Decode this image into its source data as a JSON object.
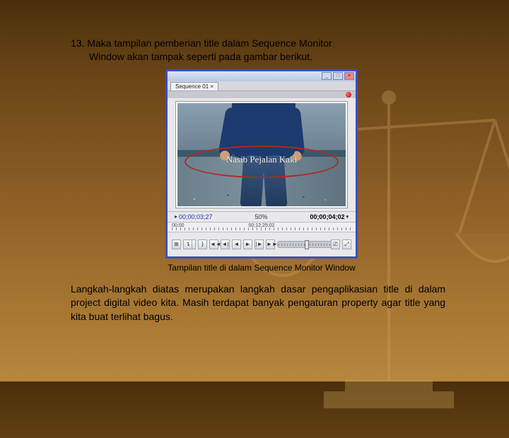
{
  "step": {
    "number": "13.",
    "line1": "13. Maka tampilan pemberian title dalam Sequence Monitor",
    "line2": "Window akan tampak seperti pada gambar berikut."
  },
  "monitor": {
    "tab_label": "Sequence 01 ×",
    "overlay_title": "Nasib Pejalan Kaki",
    "timecode_left": "00;00;03;27",
    "zoom": "50%",
    "timecode_right": "00;00;04;02",
    "ruler_start": "00;00",
    "ruler_end": "00;12;25;02",
    "window_buttons": {
      "min": "_",
      "max": "□",
      "close": "×"
    },
    "playback_icons": [
      "{",
      "}",
      "◄◄",
      "◄|",
      "◄",
      "►",
      "|►",
      "►►"
    ],
    "side_icons": [
      "⊞",
      "↴",
      "⎚",
      "⤢"
    ]
  },
  "caption": "Tampilan title di dalam Sequence Monitor Window",
  "closing": "Langkah-langkah diatas merupakan langkah dasar pengaplikasian title di dalam project digital video kita. Masih terdapat banyak pengaturan property agar title yang kita buat terlihat bagus."
}
